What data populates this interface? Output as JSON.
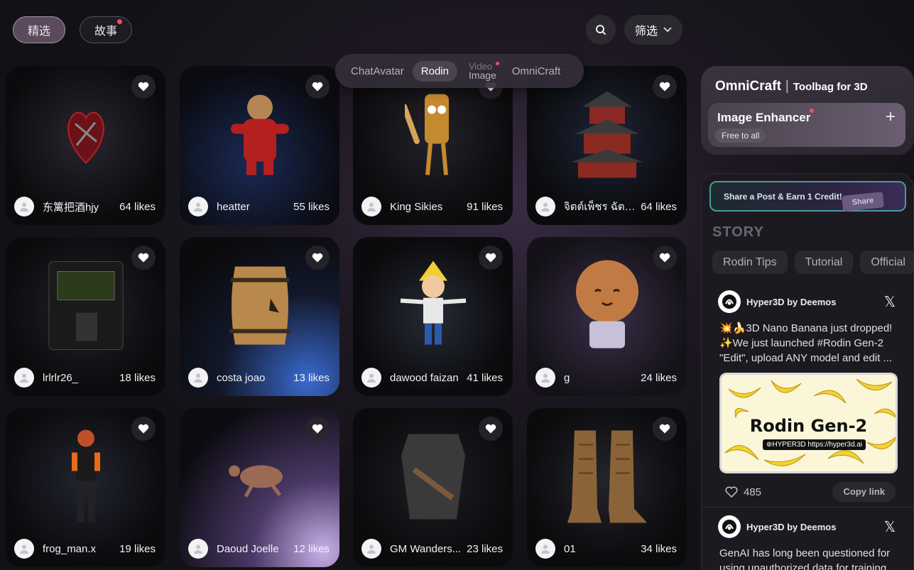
{
  "top_tabs": {
    "featured": "精选",
    "stories": "故事"
  },
  "filter": {
    "label": "筛选"
  },
  "category_tabs": [
    {
      "label": "ChatAvatar"
    },
    {
      "label": "Rodin"
    },
    {
      "label_top": "Video",
      "label_bottom": "Image"
    },
    {
      "label": "OmniCraft"
    }
  ],
  "cards": [
    {
      "user": "东篱把酒hjy",
      "likes": "64 likes",
      "model": "mechanical-heart"
    },
    {
      "user": "heatter",
      "likes": "55 likes",
      "model": "bear-in-santa-suit"
    },
    {
      "user": "King Sikies",
      "likes": "91 likes",
      "model": "bread-character-with-bat"
    },
    {
      "user": "จิตต์เพ็ชร ฉัตร...",
      "likes": "64 likes",
      "model": "chinese-pagoda"
    },
    {
      "user": "lrlrlr26_",
      "likes": "18 likes",
      "model": "retro-terminal"
    },
    {
      "user": "costa joao",
      "likes": "13 likes",
      "model": "wooden-barrel"
    },
    {
      "user": "dawood faizan",
      "likes": "41 likes",
      "model": "anime-boy"
    },
    {
      "user": "g",
      "likes": "24 likes",
      "model": "cookie-character"
    },
    {
      "user": "frog_man.x",
      "likes": "19 likes",
      "model": "armored-figure"
    },
    {
      "user": "Daoud Joelle",
      "likes": "12 likes",
      "model": "sea-turtle"
    },
    {
      "user": "GM Wanders...",
      "likes": "23 likes",
      "model": "leather-armor"
    },
    {
      "user": "01",
      "likes": "34 likes",
      "model": "leather-boots"
    }
  ],
  "omnicraft": {
    "title": "OmniCraft",
    "separator": "|",
    "subtitle": "Toolbag for 3D",
    "feature": "Image Enhancer",
    "badge": "Free to all"
  },
  "share_banner": {
    "text": "Share a Post & Earn 1 Credit!",
    "button_image": "Share"
  },
  "story": {
    "heading": "STORY",
    "tabs": [
      "Rodin Tips",
      "Tutorial",
      "Official"
    ]
  },
  "posts": [
    {
      "author": "Hyper3D by Deemos",
      "lines": [
        "💥🍌3D Nano Banana just dropped!",
        "✨We just launched #Rodin Gen-2",
        "\"Edit\", upload ANY model and edit ..."
      ],
      "image_title": "Rodin Gen-2",
      "image_url": "⊕HYPER3D https://hyper3d.ai",
      "likes": "485",
      "copy": "Copy link"
    },
    {
      "author": "Hyper3D by Deemos",
      "lines": [
        "GenAI has long been questioned for",
        "using unauthorized data for training."
      ]
    }
  ],
  "colors": {
    "accent_dot": "#ff4a5a",
    "background": "#121115",
    "card": "#0d0d10"
  }
}
